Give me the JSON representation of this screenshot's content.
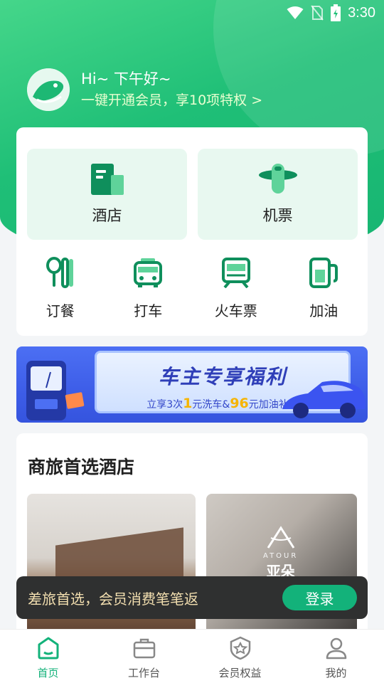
{
  "status_bar": {
    "time": "3:30"
  },
  "greeting": {
    "title": "Hi~ 下午好~",
    "subtitle": "一键开通会员，享10项特权 >"
  },
  "services": {
    "primary": [
      {
        "label": "酒店",
        "icon": "hotel-building-icon"
      },
      {
        "label": "机票",
        "icon": "airplane-icon"
      }
    ],
    "secondary": [
      {
        "label": "订餐",
        "icon": "spoon-fork-icon"
      },
      {
        "label": "打车",
        "icon": "taxi-icon"
      },
      {
        "label": "火车票",
        "icon": "train-icon"
      },
      {
        "label": "加油",
        "icon": "fuel-pump-icon"
      }
    ]
  },
  "banner": {
    "title": "车主专享福利",
    "sub_prefix": "立享3次",
    "sub_num1": "1",
    "sub_mid": "元洗车&",
    "sub_num2": "96",
    "sub_suffix": "元加油补贴"
  },
  "hotels": {
    "title": "商旅首选酒店",
    "brand": "亚朵",
    "brand_en": "ATOUR"
  },
  "toast": {
    "text": "差旅首选，会员消费笔笔返",
    "button": "登录"
  },
  "tabbar": [
    {
      "label": "首页",
      "icon": "home-icon",
      "active": true
    },
    {
      "label": "工作台",
      "icon": "briefcase-icon",
      "active": false
    },
    {
      "label": "会员权益",
      "icon": "member-badge-icon",
      "active": false
    },
    {
      "label": "我的",
      "icon": "profile-icon",
      "active": false
    }
  ],
  "colors": {
    "brand_green": "#13b27a",
    "icon_green": "#0f8f5c",
    "banner_blue": "#3d5de8"
  }
}
